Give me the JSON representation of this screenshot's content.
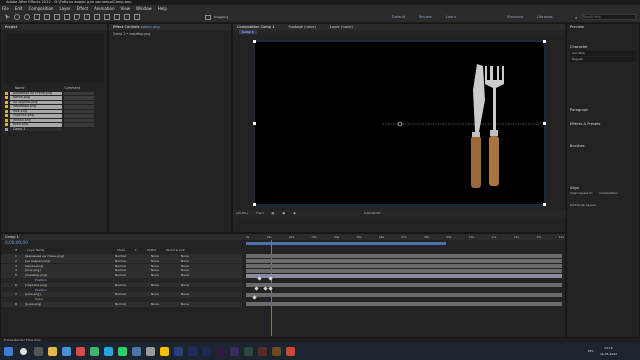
{
  "app": {
    "title": "Adobe After Effects 2022 - D:\\Работы видео для заставки\\Comp.aep",
    "menu": [
      "File",
      "Edit",
      "Composition",
      "Layer",
      "Effect",
      "Animation",
      "View",
      "Window",
      "Help"
    ]
  },
  "toolbar": {
    "snapping_label": "Snapping",
    "workspaces": [
      "Default",
      "Review",
      "Learn",
      "Standard",
      "Libraries"
    ],
    "search_placeholder": "Search Help"
  },
  "project_panel": {
    "tab": "Project",
    "comp_label": "Comp 1 • перебор.png",
    "col_name": "Name",
    "col_comment": "Comment",
    "items": [
      "деревная на стене.png",
      "вилка.png",
      "на заднем.png",
      "перебора.png",
      "нож.png",
      "тарелка.png",
      "ложка.png",
      "рука.png",
      "Comp 1"
    ]
  },
  "effect_controls": {
    "tab": "Effect Controls",
    "target": "вилка.png",
    "sub": "Comp 1 • перебор.png"
  },
  "composition_panel": {
    "tabs": [
      "Composition Comp 1",
      "Footage (none)",
      "Layer (none)"
    ],
    "comp_tab": "Comp 1",
    "zoom": "(40.8%)",
    "quality": "Third",
    "timecode": "0;00;00;00"
  },
  "right_panels": {
    "preview": "Preview",
    "character": "Character",
    "font": "Candara",
    "font_style": "Regular",
    "paragraph": "Paragraph",
    "effects_presets": "Effects & Presets",
    "brushes": "Brushes",
    "align": "Align",
    "align_to_label": "Align Layers to:",
    "align_to_value": "Composition",
    "distribute": "Distribute Layers:"
  },
  "timeline": {
    "tab": "Comp 1",
    "timecode": "0;00;00;00",
    "headers": [
      "#",
      "Layer Name",
      "Mode",
      "T",
      "TrkMat",
      "Parent & Link"
    ],
    "layers": [
      {
        "num": "1",
        "name": "[деревная на стене.png]",
        "mode": "Normal",
        "trk": "None",
        "parent": "None",
        "kind": "layer"
      },
      {
        "num": "2",
        "name": "[на заднем.png]",
        "mode": "Normal",
        "trk": "None",
        "parent": "None",
        "kind": "layer"
      },
      {
        "num": "3",
        "name": "[вилка.png]",
        "mode": "Normal",
        "trk": "None",
        "parent": "None",
        "kind": "layer"
      },
      {
        "num": "4",
        "name": "[нож.png]",
        "mode": "Normal",
        "trk": "None",
        "parent": "None",
        "kind": "layer"
      },
      {
        "num": "5",
        "name": "[перебор.png]",
        "mode": "Normal",
        "trk": "None",
        "parent": "None",
        "kind": "layer"
      },
      {
        "num": "",
        "name": "Position",
        "mode": "",
        "trk": "",
        "parent": "",
        "kind": "sub"
      },
      {
        "num": "6",
        "name": "[тарелка.png]",
        "mode": "Normal",
        "trk": "None",
        "parent": "None",
        "kind": "layer"
      },
      {
        "num": "",
        "name": "Position",
        "mode": "",
        "trk": "",
        "parent": "",
        "kind": "sub"
      },
      {
        "num": "7",
        "name": "[нож.png]",
        "mode": "Normal",
        "trk": "None",
        "parent": "None",
        "kind": "layer"
      },
      {
        "num": "",
        "name": "Scale",
        "mode": "",
        "trk": "",
        "parent": "",
        "kind": "sub"
      },
      {
        "num": "8",
        "name": "[рука.png]",
        "mode": "Normal",
        "trk": "None",
        "parent": "None",
        "kind": "layer"
      }
    ],
    "ruler": [
      "0s",
      "01s",
      "02s",
      "03s",
      "04s",
      "05s",
      "06s",
      "07s",
      "08s",
      "09s",
      "10s",
      "11s",
      "12s",
      "13s",
      "14s"
    ],
    "footer": "Frame Render Time  0ms"
  },
  "taskbar": {
    "time": "14:18",
    "date": "16.05.2022",
    "lang": "РУС"
  },
  "colors": {
    "accent": "#2d8ceb",
    "panel": "#232323",
    "label": "#e0b040"
  }
}
